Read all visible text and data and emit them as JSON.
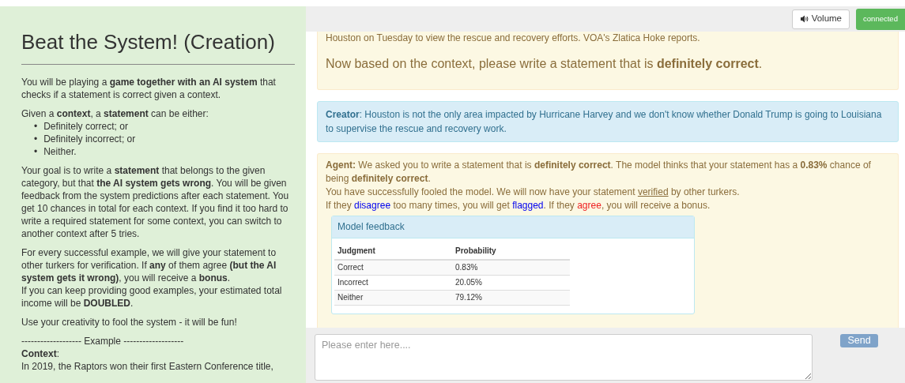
{
  "sidebar": {
    "title": "Beat the System! (Creation)",
    "blocks": [
      {
        "kind": "p",
        "text": "You will be playing a **game together with an AI system** that checks if a statement is correct given a context."
      },
      {
        "kind": "p",
        "text": "Given a **context**, a **statement** can be either:"
      },
      {
        "kind": "list",
        "marker": "•",
        "items": [
          "Definitely correct; or",
          "Definitely incorrect; or",
          "Neither."
        ]
      },
      {
        "kind": "p",
        "text": "Your goal is to write a **statement** that belongs to the given category, but that **the AI system gets wrong**. You will be given feedback from the system predictions after each statement. You get 10 chances in total for each context. If you find it too hard to write a required statement for some context, you can switch to another context after 5 tries."
      },
      {
        "kind": "p",
        "text": "For every successful example, we will give your statement to other turkers for verification. If **any** of them agree **(but the AI system gets it wrong)**, you will receive a **bonus**."
      },
      {
        "kind": "line",
        "text": "If you can keep providing good examples, your estimated total income will be **DOUBLED**."
      },
      {
        "kind": "p",
        "text": "Use your creativity to fool the system - it will be fun!"
      },
      {
        "kind": "p",
        "text": "------------------- Example -------------------"
      },
      {
        "kind": "line",
        "text": "**Context**:"
      },
      {
        "kind": "line",
        "text": "In 2019, the Raptors won their first Eastern Conference title,"
      }
    ]
  },
  "toolbar": {
    "volume": "Volume",
    "status": "connected",
    "connected": true
  },
  "prompt": {
    "context_tail": "Houston on Tuesday to view the rescue and recovery efforts. VOA's Zlatica Hoke reports.",
    "instruction": "Now based on the context, please write a statement that is **definitely correct**."
  },
  "creator": {
    "text": "**Creator**: Houston is not the only area impacted by Hurricane Harvey and we don't know whether Donald Trump is going to Louisiana to supervise the rescue and recovery work."
  },
  "agent": {
    "summary": "**Agent:** We asked you to write a statement that is **definitely correct**. The model thinks that your statement has a **0.83%** chance of being **definitely correct**.",
    "lines": [
      [
        {
          "kind": "plain",
          "text": "You have successfully fooled the model. We will now have your statement "
        },
        {
          "kind": "underline",
          "text": "verified"
        },
        {
          "kind": "plain",
          "text": " by other turkers."
        }
      ],
      [
        {
          "kind": "plain",
          "text": "If they "
        },
        {
          "kind": "blue",
          "text": "disagree"
        },
        {
          "kind": "plain",
          "text": " too many times, you will get "
        },
        {
          "kind": "blue",
          "text": "flagged"
        },
        {
          "kind": "plain",
          "text": ". If they "
        },
        {
          "kind": "red",
          "text": "agree"
        },
        {
          "kind": "plain",
          "text": ", you will receive a bonus."
        }
      ]
    ],
    "feedback": {
      "title": "Model feedback",
      "columns": [
        "Judgment",
        "Probability"
      ],
      "rows": [
        [
          "Correct",
          "0.83%"
        ],
        [
          "Incorrect",
          "20.05%"
        ],
        [
          "Neither",
          "79.12%"
        ]
      ]
    }
  },
  "composer": {
    "placeholder": "Please enter here....",
    "send": "Send",
    "send_disabled": true
  }
}
